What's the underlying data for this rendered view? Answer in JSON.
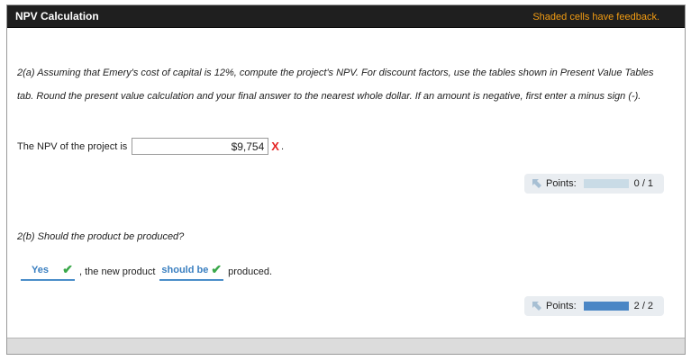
{
  "header": {
    "title": "NPV Calculation",
    "note": "Shaded cells have feedback."
  },
  "part_a": {
    "question": "2(a) Assuming that Emery's cost of capital is 12%, compute the project's NPV. For discount factors, use the tables shown in Present Value Tables tab. Round the present value calculation and your final answer to the nearest whole dollar. If an amount is negative, first enter a minus sign (-).",
    "npv_label": "The NPV of the project is",
    "npv_value": "$9,754",
    "incorrect_mark": "X",
    "period": ".",
    "points_label": "Points:",
    "points_score": "0 / 1",
    "points_fraction": 0
  },
  "part_b": {
    "question": "2(b) Should the product be produced?",
    "answer1": "Yes",
    "text_middle": ", the new product",
    "answer2": "should be",
    "text_end": "produced.",
    "check_mark": "✔",
    "points_label": "Points:",
    "points_score": "2 / 2",
    "points_fraction": 1
  },
  "colors": {
    "header_bg": "#1f1f1f",
    "header_note": "#f39c12",
    "incorrect": "#e52323",
    "correct": "#3aa84a",
    "dropdown": "#3a7fc0",
    "points_fill": "#4a86c5"
  }
}
